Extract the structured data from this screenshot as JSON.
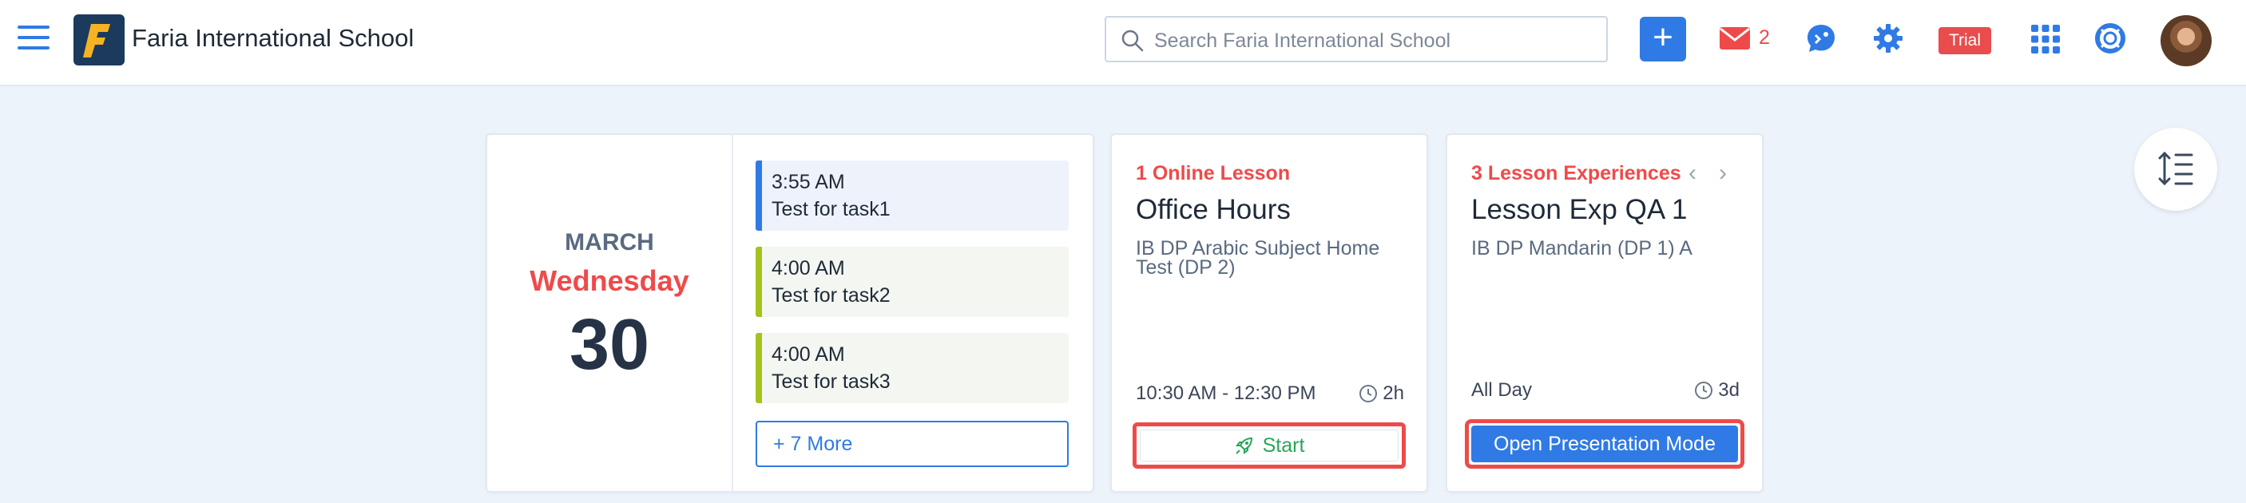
{
  "header": {
    "school_name": "Faria International School",
    "search_placeholder": "Search Faria International School",
    "mail_count": "2",
    "trial_label": "Trial"
  },
  "date_card": {
    "month": "MARCH",
    "weekday": "Wednesday",
    "day": "30",
    "tasks": [
      {
        "time": "3:55 AM",
        "title": "Test for task1"
      },
      {
        "time": "4:00 AM",
        "title": "Test for task2"
      },
      {
        "time": "4:00 AM",
        "title": "Test for task3"
      }
    ],
    "more_label": "+ 7 More"
  },
  "lesson_card": {
    "label": "1 Online Lesson",
    "title": "Office Hours",
    "subtitle": "IB DP Arabic Subject Home Test (DP 2)",
    "time": "10:30 AM - 12:30 PM",
    "duration": "2h",
    "start_label": "Start"
  },
  "experience_card": {
    "label": "3 Lesson Experiences",
    "title": "Lesson Exp QA 1",
    "subtitle": "IB DP Mandarin (DP 1) A",
    "time": "All Day",
    "duration": "3d",
    "button_label": "Open Presentation Mode"
  },
  "colors": {
    "accent": "#2f7ae5",
    "alert": "#ef4a4a",
    "success": "#2aa55a",
    "task_green": "#a5c31d",
    "background": "#edf3fb"
  },
  "icons": [
    "hamburger-menu-icon",
    "search-icon",
    "plus-icon",
    "mail-icon",
    "chat-icon",
    "gear-icon",
    "apps-grid-icon",
    "help-lifebuoy-icon",
    "clock-icon",
    "rocket-icon",
    "chevron-left-icon",
    "chevron-right-icon",
    "line-spacing-icon"
  ]
}
